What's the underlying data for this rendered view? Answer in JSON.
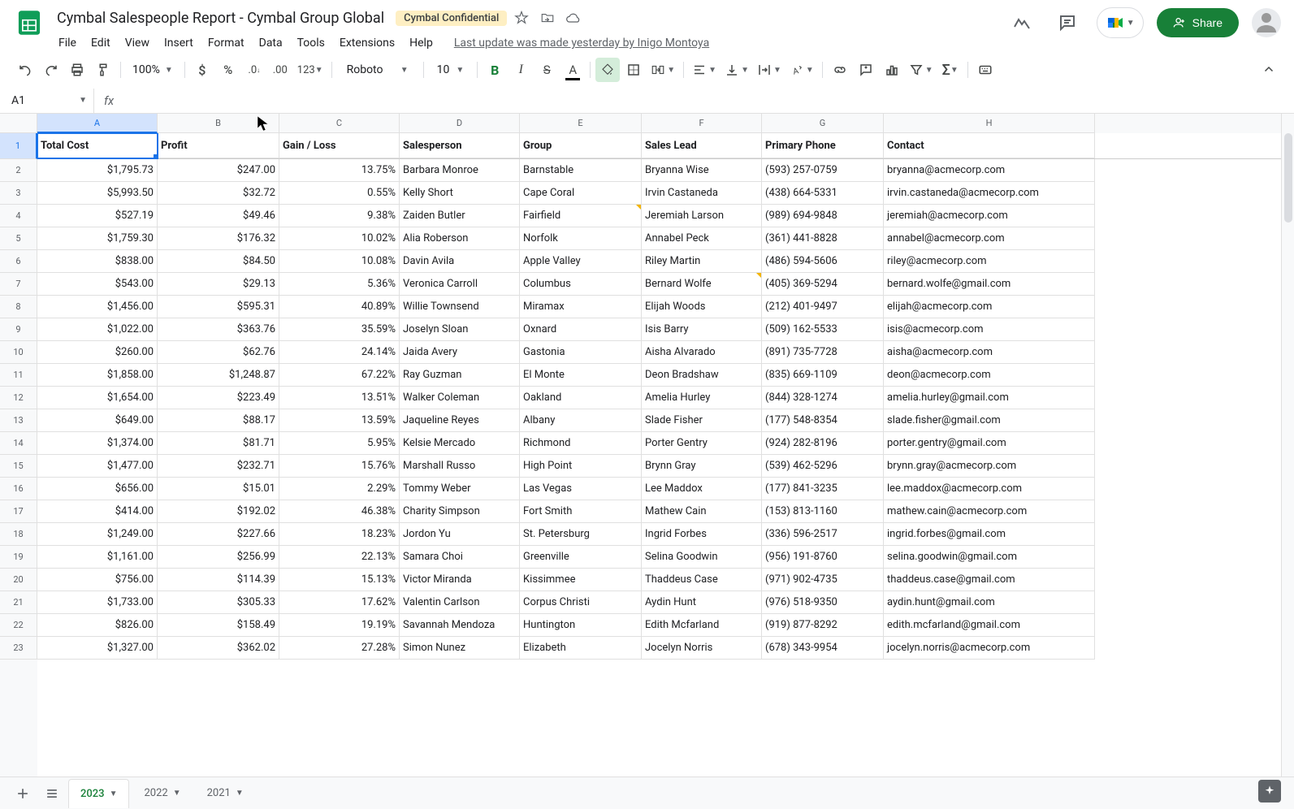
{
  "doc": {
    "title": "Cymbal Salespeople Report - Cymbal Group Global",
    "badge": "Cymbal Confidential",
    "last_update": "Last update was made yesterday by Inigo Montoya"
  },
  "menu": [
    "File",
    "Edit",
    "View",
    "Insert",
    "Format",
    "Data",
    "Tools",
    "Extensions",
    "Help"
  ],
  "toolbar": {
    "zoom": "100%",
    "font": "Roboto",
    "size": "10"
  },
  "share_label": "Share",
  "namebox": "A1",
  "formula": "",
  "columns": [
    "A",
    "B",
    "C",
    "D",
    "E",
    "F",
    "G",
    "H"
  ],
  "headers": [
    "Total Cost",
    "Profit",
    "Gain / Loss",
    "Salesperson",
    "Group",
    "Sales Lead",
    "Primary Phone",
    "Contact"
  ],
  "rows": [
    [
      "$1,795.73",
      "$247.00",
      "13.75%",
      "Barbara Monroe",
      "Barnstable",
      "Bryanna Wise",
      "(593) 257-0759",
      "bryanna@acmecorp.com"
    ],
    [
      "$5,993.50",
      "$32.72",
      "0.55%",
      "Kelly Short",
      "Cape Coral",
      "Irvin Castaneda",
      "(438) 664-5331",
      "irvin.castaneda@acmecorp.com"
    ],
    [
      "$527.19",
      "$49.46",
      "9.38%",
      "Zaiden Butler",
      "Fairfield",
      "Jeremiah Larson",
      "(989) 694-9848",
      "jeremiah@acmecorp.com"
    ],
    [
      "$1,759.30",
      "$176.32",
      "10.02%",
      "Alia Roberson",
      "Norfolk",
      "Annabel Peck",
      "(361) 441-8828",
      "annabel@acmecorp.com"
    ],
    [
      "$838.00",
      "$84.50",
      "10.08%",
      "Davin Avila",
      "Apple Valley",
      "Riley Martin",
      "(486) 594-5606",
      "riley@acmecorp.com"
    ],
    [
      "$543.00",
      "$29.13",
      "5.36%",
      "Veronica Carroll",
      "Columbus",
      "Bernard Wolfe",
      "(405) 369-5294",
      "bernard.wolfe@gmail.com"
    ],
    [
      "$1,456.00",
      "$595.31",
      "40.89%",
      "Willie Townsend",
      "Miramax",
      "Elijah Woods",
      "(212) 401-9497",
      "elijah@acmecorp.com"
    ],
    [
      "$1,022.00",
      "$363.76",
      "35.59%",
      "Joselyn Sloan",
      "Oxnard",
      "Isis Barry",
      "(509) 162-5533",
      "isis@acmecorp.com"
    ],
    [
      "$260.00",
      "$62.76",
      "24.14%",
      "Jaida Avery",
      "Gastonia",
      "Aisha Alvarado",
      "(891) 735-7728",
      "aisha@acmecorp.com"
    ],
    [
      "$1,858.00",
      "$1,248.87",
      "67.22%",
      "Ray Guzman",
      "El Monte",
      "Deon Bradshaw",
      "(835) 669-1109",
      "deon@acmecorp.com"
    ],
    [
      "$1,654.00",
      "$223.49",
      "13.51%",
      "Walker Coleman",
      "Oakland",
      "Amelia Hurley",
      "(844) 328-1274",
      "amelia.hurley@gmail.com"
    ],
    [
      "$649.00",
      "$88.17",
      "13.59%",
      "Jaqueline Reyes",
      "Albany",
      "Slade Fisher",
      "(177) 548-8354",
      "slade.fisher@gmail.com"
    ],
    [
      "$1,374.00",
      "$81.71",
      "5.95%",
      "Kelsie Mercado",
      "Richmond",
      "Porter Gentry",
      "(924) 282-8196",
      "porter.gentry@gmail.com"
    ],
    [
      "$1,477.00",
      "$232.71",
      "15.76%",
      "Marshall Russo",
      "High Point",
      "Brynn Gray",
      "(539) 462-5296",
      "brynn.gray@acmecorp.com"
    ],
    [
      "$656.00",
      "$15.01",
      "2.29%",
      "Tommy Weber",
      "Las Vegas",
      "Lee Maddox",
      "(177) 841-3235",
      "lee.maddox@acmecorp.com"
    ],
    [
      "$414.00",
      "$192.02",
      "46.38%",
      "Charity Simpson",
      "Fort Smith",
      "Mathew Cain",
      "(153) 813-1160",
      "mathew.cain@acmecorp.com"
    ],
    [
      "$1,249.00",
      "$227.66",
      "18.23%",
      "Jordon Yu",
      "St. Petersburg",
      "Ingrid Forbes",
      "(336) 596-2517",
      "ingrid.forbes@gmail.com"
    ],
    [
      "$1,161.00",
      "$256.99",
      "22.13%",
      "Samara Choi",
      "Greenville",
      "Selina Goodwin",
      "(956) 191-8760",
      "selina.goodwin@gmail.com"
    ],
    [
      "$756.00",
      "$114.39",
      "15.13%",
      "Victor Miranda",
      "Kissimmee",
      "Thaddeus Case",
      "(971) 902-4735",
      "thaddeus.case@gmail.com"
    ],
    [
      "$1,733.00",
      "$305.33",
      "17.62%",
      "Valentin Carlson",
      "Corpus Christi",
      "Aydin Hunt",
      "(976) 518-9350",
      "aydin.hunt@gmail.com"
    ],
    [
      "$826.00",
      "$158.49",
      "19.19%",
      "Savannah Mendoza",
      "Huntington",
      "Edith Mcfarland",
      "(919) 877-8292",
      "edith.mcfarland@gmail.com"
    ],
    [
      "$1,327.00",
      "$362.02",
      "27.28%",
      "Simon Nunez",
      "Elizabeth",
      "Jocelyn Norris",
      "(678) 343-9954",
      "jocelyn.norris@acmecorp.com"
    ]
  ],
  "note_cells": [
    {
      "r": 2,
      "c": 4
    },
    {
      "r": 5,
      "c": 5
    }
  ],
  "selected_cell": "A1",
  "sheets": [
    {
      "name": "2023",
      "active": true
    },
    {
      "name": "2022",
      "active": false
    },
    {
      "name": "2021",
      "active": false
    }
  ]
}
